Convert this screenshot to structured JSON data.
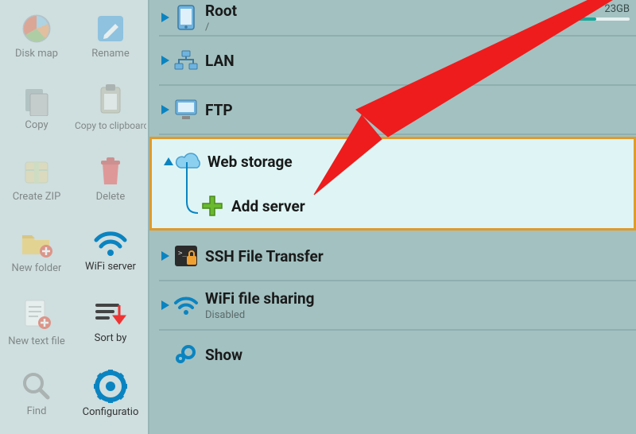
{
  "sidebar": {
    "items": [
      {
        "label": "Disk map",
        "icon": "diskmap-icon",
        "faded": true
      },
      {
        "label": "Rename",
        "icon": "rename-icon",
        "faded": true
      },
      {
        "label": "Copy",
        "icon": "copy-icon",
        "faded": true
      },
      {
        "label": "Copy to clipboard",
        "icon": "clipboard-icon",
        "faded": true
      },
      {
        "label": "Create ZIP",
        "icon": "zip-icon",
        "faded": true
      },
      {
        "label": "Delete",
        "icon": "delete-icon",
        "faded": true
      },
      {
        "label": "New folder",
        "icon": "newfolder-icon",
        "faded": true
      },
      {
        "label": "WiFi server",
        "icon": "wifi-icon",
        "faded": false
      },
      {
        "label": "New text file",
        "icon": "newtextfile-icon",
        "faded": true
      },
      {
        "label": "Sort by",
        "icon": "sort-icon",
        "faded": false
      },
      {
        "label": "Find",
        "icon": "search-icon",
        "faded": true
      },
      {
        "label": "Configuratio",
        "icon": "config-icon",
        "faded": false
      }
    ]
  },
  "main": {
    "root": {
      "title": "Root",
      "path": "/",
      "storage_text": "23GB",
      "storage_pct": 55
    },
    "lan": {
      "title": "LAN"
    },
    "ftp": {
      "title": "FTP"
    },
    "web_storage": {
      "title": "Web storage"
    },
    "add_server": {
      "title": "Add server"
    },
    "ssh": {
      "title": "SSH File Transfer"
    },
    "wifi_share": {
      "title": "WiFi file sharing",
      "sub": "Disabled"
    },
    "show": {
      "title": "Show"
    }
  },
  "colors": {
    "highlight_border": "#e09a2a",
    "highlight_bg": "#dff5f5",
    "accent": "#0a84c1"
  }
}
